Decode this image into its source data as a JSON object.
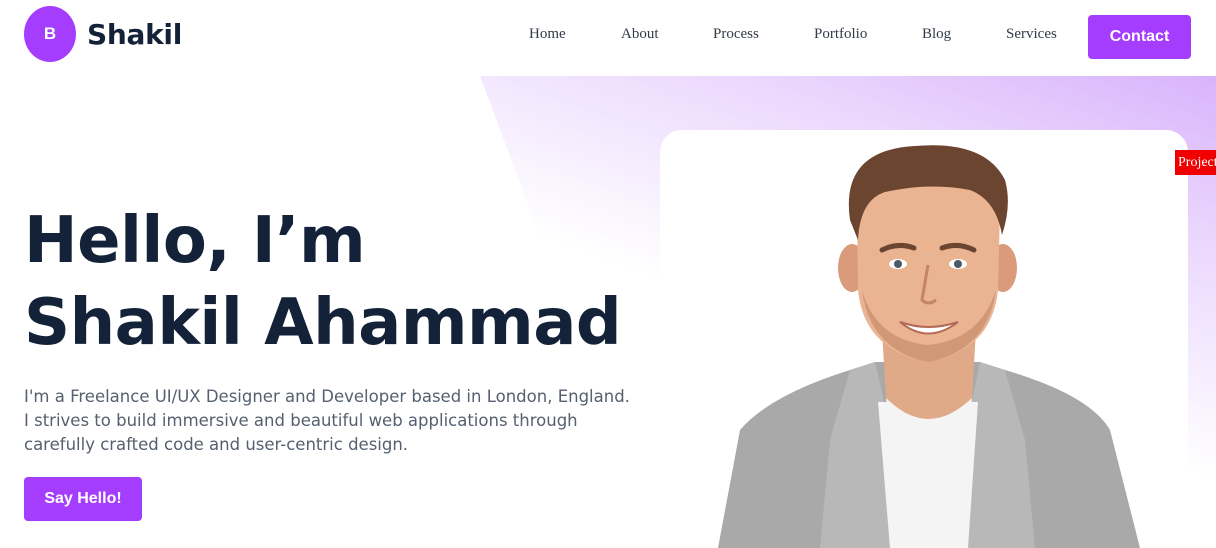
{
  "brand": {
    "initial": "B",
    "name": "Shakil",
    "accent": "#a53dff"
  },
  "nav": {
    "items": [
      {
        "label": "Home"
      },
      {
        "label": "About"
      },
      {
        "label": "Process"
      },
      {
        "label": "Portfolio"
      },
      {
        "label": "Blog"
      },
      {
        "label": "Services"
      }
    ],
    "contact_label": "Contact"
  },
  "side_tab": {
    "label": "Projects",
    "color": "#f00000"
  },
  "hero": {
    "title_line1": "Hello, I’m",
    "title_line2": "Shakil Ahammad",
    "description": "I'm a Freelance UI/UX Designer and Developer based in London, England. I strives to build immersive and beautiful web applications through carefully crafted code and user-centric design.",
    "cta_label": "Say Hello!"
  },
  "portrait": {
    "icon": "person-photo"
  }
}
